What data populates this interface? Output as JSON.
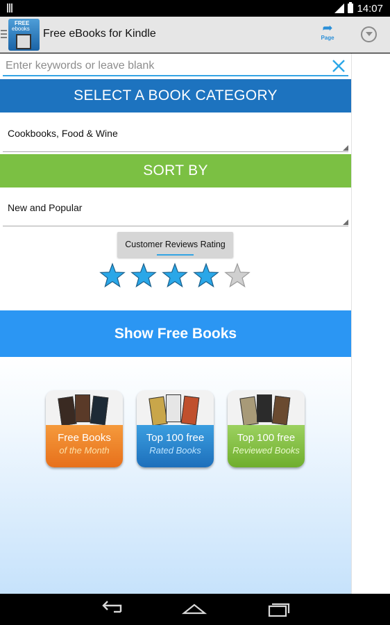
{
  "status_bar": {
    "time": "14:07"
  },
  "app": {
    "title": "Free eBooks for Kindle",
    "logo_top": "FREE",
    "logo_bottom": "ebooks"
  },
  "toolbar": {
    "page_label": "Page"
  },
  "search": {
    "placeholder": "Enter keywords or leave blank",
    "value": ""
  },
  "category": {
    "header": "SELECT A BOOK CATEGORY",
    "selected": "Cookbooks, Food & Wine"
  },
  "sort": {
    "header": "SORT BY",
    "selected": "New and Popular"
  },
  "rating": {
    "button_label": "Customer Reviews Rating",
    "value": 4,
    "max": 5,
    "filled_color": "#2aa7e8",
    "empty_color": "#cfcfcf"
  },
  "show_button": {
    "label": "Show Free Books"
  },
  "tiles": [
    {
      "line1": "Free Books",
      "line2": "of the Month",
      "color": "#ee8428"
    },
    {
      "line1": "Top 100 free",
      "line2": "Rated Books",
      "color": "#2a86d0"
    },
    {
      "line1": "Top 100 free",
      "line2": "Reviewed Books",
      "color": "#83c147"
    }
  ]
}
